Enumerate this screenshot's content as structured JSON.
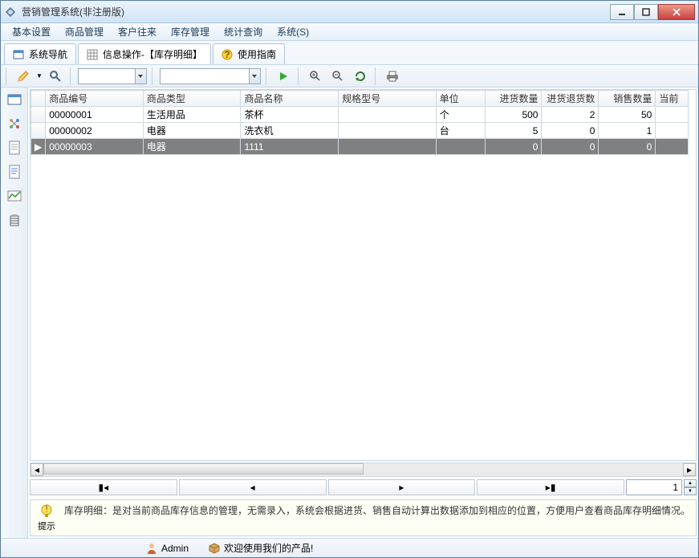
{
  "window": {
    "title": "营销管理系统(非注册版)"
  },
  "menu": [
    "基本设置",
    "商品管理",
    "客户往来",
    "库存管理",
    "统计查询",
    "系统(S)"
  ],
  "tabs": [
    {
      "label": "系统导航"
    },
    {
      "label": "信息操作-【库存明细】"
    },
    {
      "label": "使用指南"
    }
  ],
  "grid": {
    "columns": [
      "商品编号",
      "商品类型",
      "商品名称",
      "规格型号",
      "单位",
      "进货数量",
      "进货退货数",
      "销售数量",
      "当前"
    ],
    "rows": [
      {
        "id": "00000001",
        "type": "生活用品",
        "name": "茶杯",
        "spec": "",
        "unit": "个",
        "in": "500",
        "ret": "2",
        "sale": "50"
      },
      {
        "id": "00000002",
        "type": "电器",
        "name": "洗衣机",
        "spec": "",
        "unit": "台",
        "in": "5",
        "ret": "0",
        "sale": "1"
      },
      {
        "id": "00000003",
        "type": "电器",
        "name": "1111",
        "spec": "",
        "unit": "",
        "in": "0",
        "ret": "0",
        "sale": "0",
        "selected": true
      }
    ]
  },
  "nav": {
    "page": "1"
  },
  "hint": {
    "label": "提示",
    "text": "库存明细：是对当前商品库存信息的管理，无需录入，系统会根据进货、销售自动计算出数据添加到相应的位置，方便用户查看商品库存明细情况。"
  },
  "status": {
    "user": "Admin",
    "welcome": "欢迎使用我们的产品!"
  }
}
